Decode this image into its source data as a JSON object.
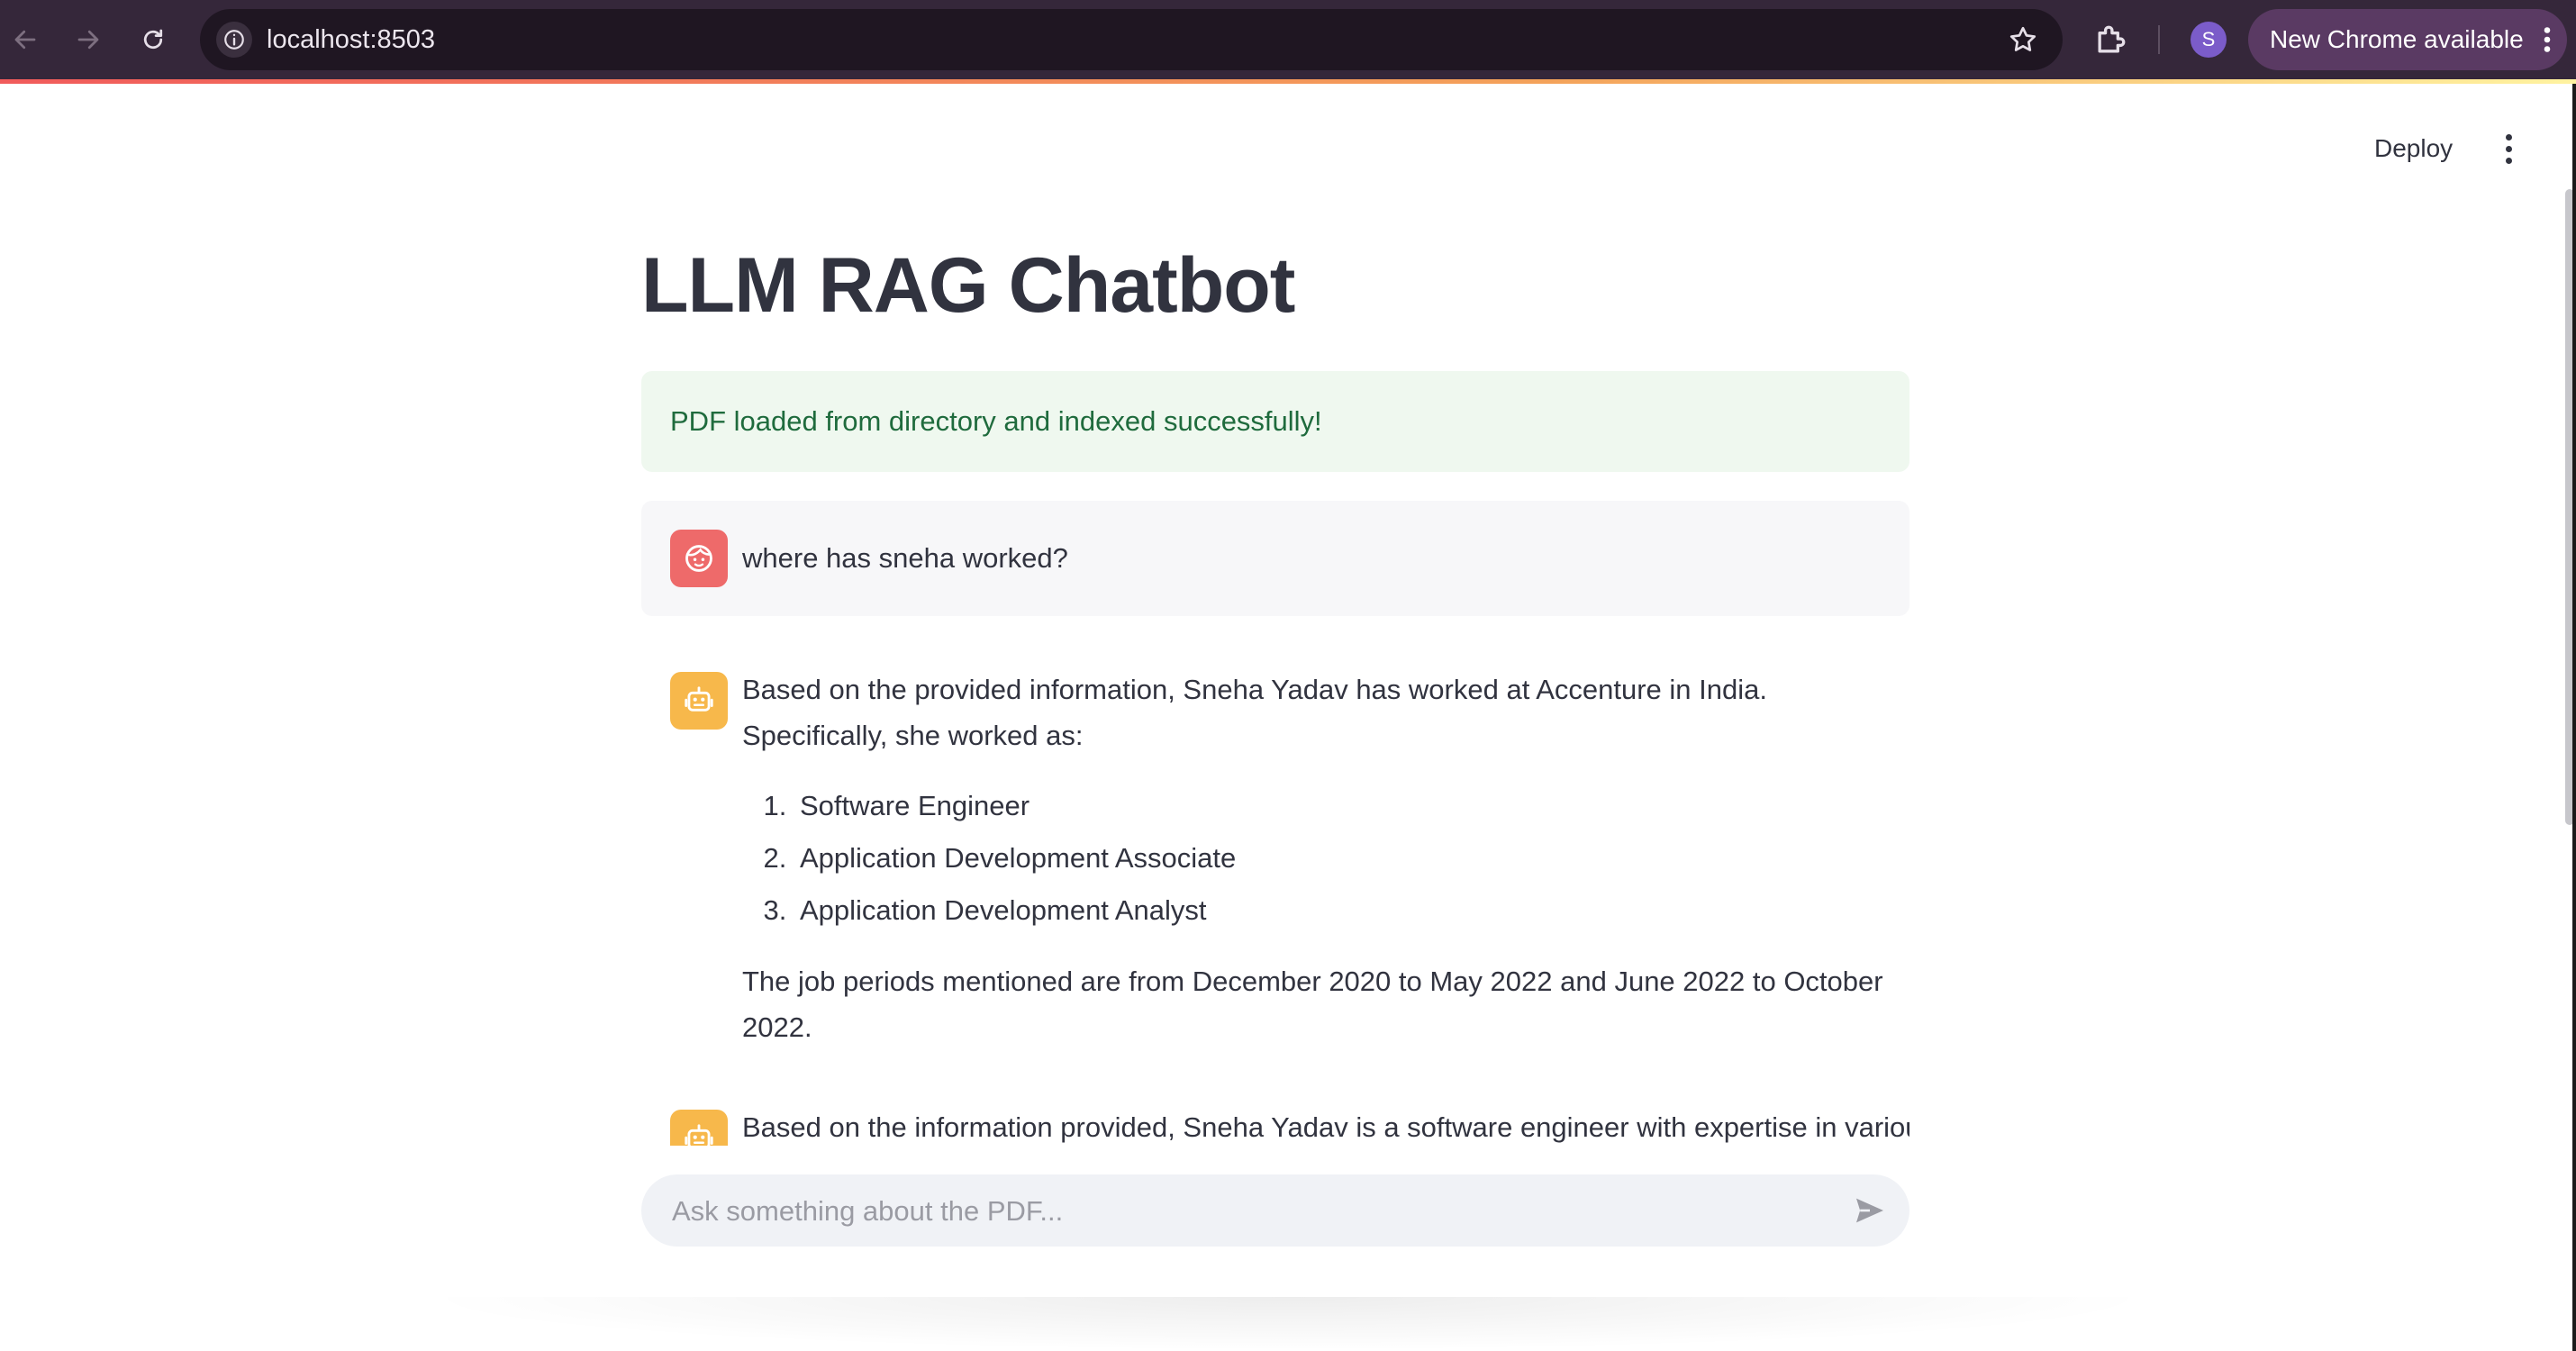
{
  "browser": {
    "url": "localhost:8503",
    "profile_initial": "S",
    "update_label": "New Chrome available"
  },
  "toolbar": {
    "deploy_label": "Deploy"
  },
  "main": {
    "title": "LLM RAG Chatbot",
    "success_message": "PDF loaded from directory and indexed successfully!"
  },
  "chat": {
    "messages": [
      {
        "role": "user",
        "text": "where has sneha worked?"
      },
      {
        "role": "assistant",
        "intro": "Based on the provided information, Sneha Yadav has worked at Accenture in India. Specifically, she worked as:",
        "list": [
          "Software Engineer",
          "Application Development Associate",
          "Application Development Analyst"
        ],
        "outro": "The job periods mentioned are from December 2020 to May 2022 and June 2022 to October 2022."
      },
      {
        "role": "assistant",
        "text": "Based on the information provided, Sneha Yadav is a software engineer with expertise in various"
      }
    ],
    "input_placeholder": "Ask something about the PDF..."
  },
  "icons": {
    "back": "arrow-left-icon",
    "forward": "arrow-right-icon",
    "reload": "reload-icon",
    "site_info": "info-icon",
    "bookmark": "star-icon",
    "extensions": "puzzle-icon",
    "user_avatar": "user-face-icon",
    "assistant_avatar": "robot-icon",
    "send": "send-icon"
  },
  "colors": {
    "chrome_bar": "#35273a",
    "update_chip": "#5a3a63",
    "success_bg": "#eff8ef",
    "success_text": "#1f6b3d",
    "user_avatar": "#ee6a6a",
    "assistant_avatar": "#f7b84b",
    "text": "#31333f"
  }
}
